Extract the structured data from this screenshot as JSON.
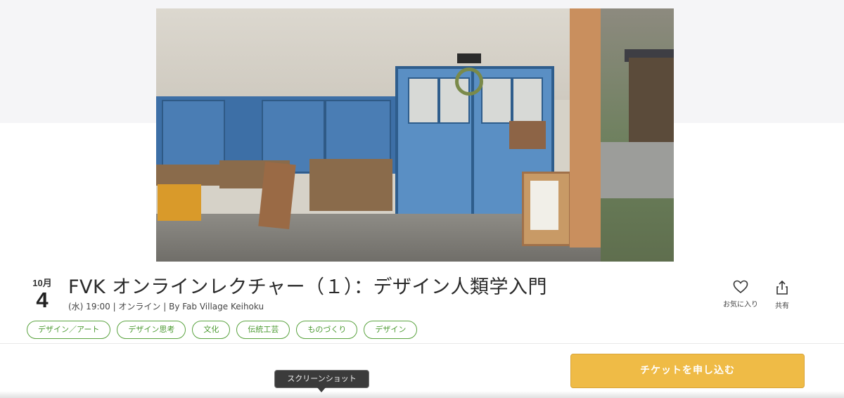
{
  "hero": {
    "icon": "hero-photo"
  },
  "event": {
    "month": "10月",
    "day": "4",
    "title": "FVK オンラインレクチャー（１）：デザイン人類学入門",
    "subtitle": "(水) 19:00 | オンライン | By Fab Village Keihoku"
  },
  "actions": {
    "favorite_label": "お気に入り",
    "share_label": "共有",
    "favorite_icon": "heart-icon",
    "share_icon": "share-icon"
  },
  "tags": [
    "デザイン／アート",
    "デザイン思考",
    "文化",
    "伝統工芸",
    "ものづくり",
    "デザイン"
  ],
  "ticket": {
    "label": "チケットを申し込む"
  },
  "tooltip": {
    "text": "スクリーンショット"
  },
  "colors": {
    "tag_accent": "#5aa33f",
    "ticket_bg": "#efbb46",
    "top_band": "#f5f5f7"
  }
}
